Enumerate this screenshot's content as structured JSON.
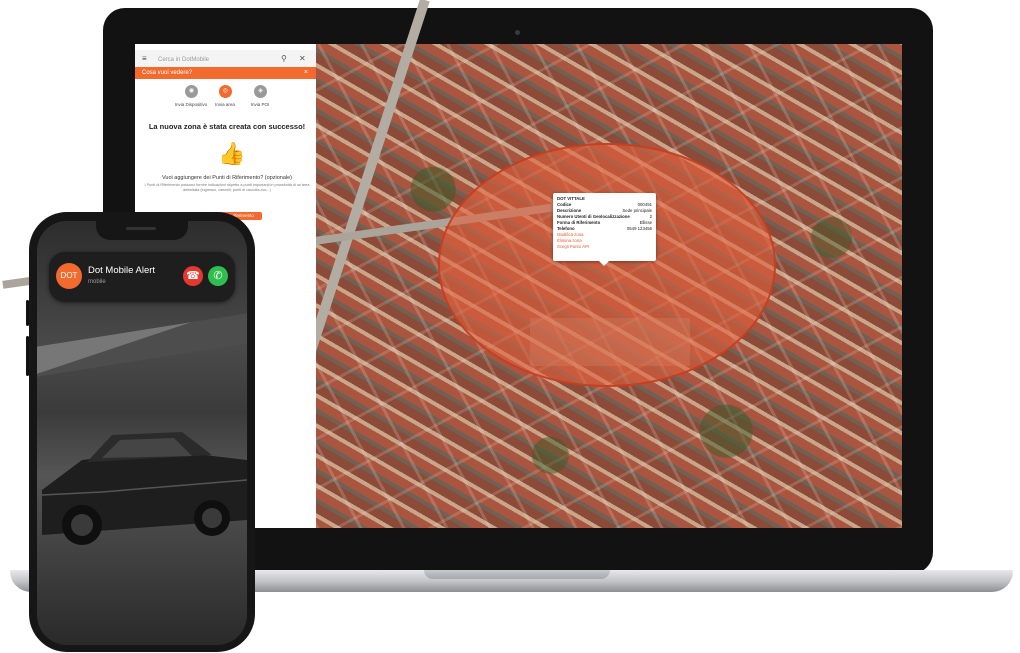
{
  "panel": {
    "search_placeholder": "Cerca in DotMobile",
    "banner_text": "Cosa vuoi vedere?",
    "options": [
      {
        "label": "Invia Dispositivo",
        "selected": false
      },
      {
        "label": "Invia area",
        "selected": true
      },
      {
        "label": "Invia POI",
        "selected": false
      }
    ],
    "success_message": "La nuova zona è stata creata con successo!",
    "optional_title": "Vuoi aggiungere dei Punti di Riferimento? (opzionale)",
    "optional_desc": "I Punti di Riferimento possono fornire indicazioni rispetto a punti importanti in prossimità di un'area delimitata (ingresso, cancelli, punti di raccolta ecc...)",
    "button_label": "Aggiungi punti di riferimento"
  },
  "map_popup": {
    "title": "DOT VITTALE",
    "rows": [
      {
        "key": "Codice",
        "value": "000491"
      },
      {
        "key": "Descrizione",
        "value": "Sede principale"
      },
      {
        "key": "Numero Utenti di Geolocalizzazione",
        "value": "2"
      },
      {
        "key": "Forma di Riferimento",
        "value": "Ellisse"
      },
      {
        "key": "Telefono",
        "value": "0549 123456"
      }
    ],
    "links": [
      "Modifica zona",
      "Elimina zona",
      "Scegli Punto API"
    ]
  },
  "call": {
    "avatar_text": "DOT",
    "caller_name": "Dot Mobile Alert",
    "caller_type": "mobile"
  },
  "colors": {
    "accent": "#f26a2e",
    "zone_fill": "#e4603c",
    "decline": "#e5392f",
    "accept": "#2ebf4e"
  },
  "icons": [
    "menu-icon",
    "search-icon",
    "close-icon",
    "thumbs-up-icon",
    "phone-decline-icon",
    "phone-accept-icon"
  ]
}
